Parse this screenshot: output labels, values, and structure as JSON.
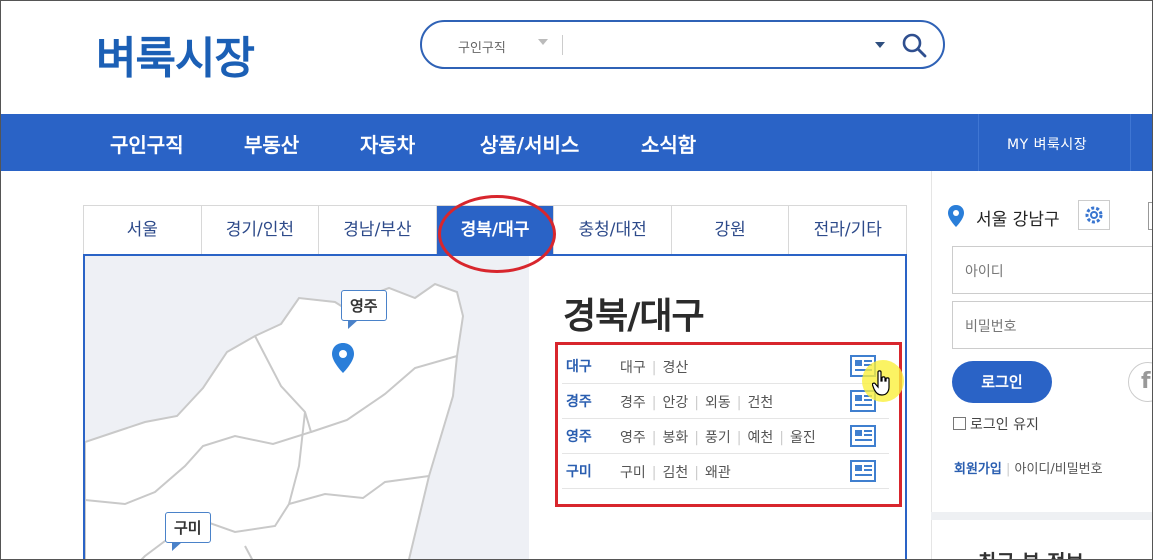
{
  "header": {
    "logo": "벼룩시장",
    "search": {
      "category": "구인구직",
      "query": ""
    }
  },
  "nav": {
    "items": [
      "구인구직",
      "부동산",
      "자동차",
      "상품/서비스",
      "소식함"
    ],
    "my": "MY 벼룩시장"
  },
  "tabs": [
    "서울",
    "경기/인천",
    "경남/부산",
    "경북/대구",
    "충청/대전",
    "강원",
    "전라/기타"
  ],
  "active_tab": "경북/대구",
  "map": {
    "labels": [
      "영주",
      "구미"
    ]
  },
  "region": {
    "title": "경북/대구",
    "rows": [
      {
        "head": "대구",
        "subs": [
          "대구",
          "경산"
        ]
      },
      {
        "head": "경주",
        "subs": [
          "경주",
          "안강",
          "외동",
          "건천"
        ]
      },
      {
        "head": "영주",
        "subs": [
          "영주",
          "봉화",
          "풍기",
          "예천",
          "울진"
        ]
      },
      {
        "head": "구미",
        "subs": [
          "구미",
          "김천",
          "왜관"
        ]
      }
    ]
  },
  "sidebar": {
    "location": "서울 강남구",
    "id_placeholder": "아이디",
    "pw_placeholder": "비밀번호",
    "login_label": "로그인",
    "keep_login": "로그인 유지",
    "join": "회원가입",
    "find": "아이디/비밀번호 ",
    "bottom_fragment": "최근 본 정보"
  },
  "colors": {
    "brand": "#2a63c6",
    "logo": "#1b5fb5",
    "highlight": "#d8262d"
  }
}
